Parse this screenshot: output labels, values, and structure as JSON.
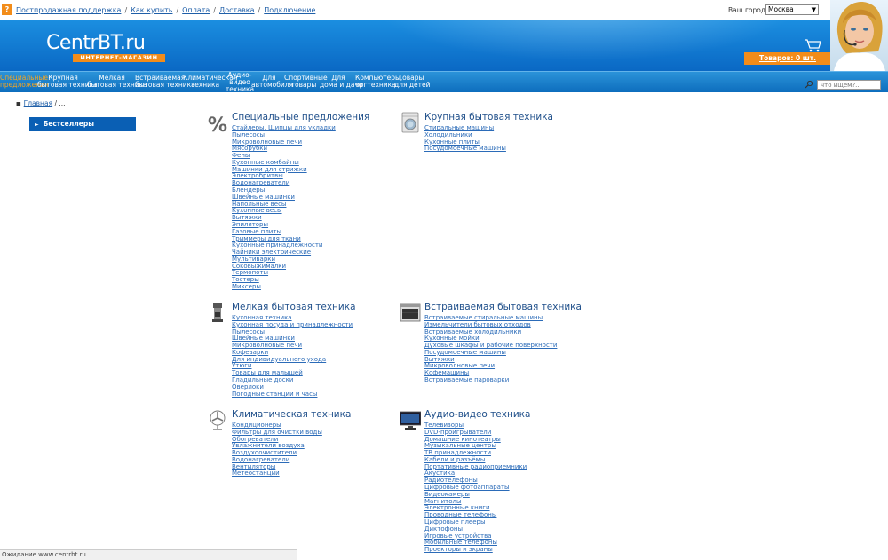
{
  "topbar": {
    "help_icon": "?",
    "links": [
      "Постпродажная поддержка",
      "Как купить",
      "Оплата",
      "Доставка",
      "Подключение"
    ],
    "city_label": "Ваш город:",
    "city_value": "Москва"
  },
  "header": {
    "logo_main": "CentrBT.ru",
    "logo_sub": "ИНТЕРНЕТ-МАГАЗИН",
    "cart_text": "Товаров: 0 шт."
  },
  "nav": [
    {
      "label": "Специальные\nпредложения",
      "active": true
    },
    {
      "label": "Крупная\nбытовая техника"
    },
    {
      "label": "Мелкая\nбытовая техника"
    },
    {
      "label": "Встраиваемая\nбытовая техника"
    },
    {
      "label": "Климатическая\nтехника"
    },
    {
      "label": "Аудио-\nвидео\nтехника"
    },
    {
      "label": "Для\nавтомобиля"
    },
    {
      "label": "Спортивные\nтовары"
    },
    {
      "label": "Для\nдома и дачи"
    },
    {
      "label": "Компьютеры,\nоргтехника"
    },
    {
      "label": "Товары\nдля детей"
    }
  ],
  "search": {
    "placeholder": "что ищем?.."
  },
  "breadcrumb": {
    "home": "Главная",
    "tail": " / ..."
  },
  "left_panel": {
    "bestsellers": "Бестселлеры"
  },
  "categories": [
    {
      "title": "Специальные предложения",
      "icon": "percent-icon",
      "items": [
        "Стайлеры, Щипцы для укладки",
        "Пылесосы",
        "Микроволновые печи",
        "Мясорубки",
        "Фены",
        "Кухонные комбайны",
        "Машинки для стрижки",
        "Электробритвы",
        "Водонагреватели",
        "Блендеры",
        "Швейные машинки",
        "Напольные весы",
        "Кухонные весы",
        "Вытяжки",
        "Эпиляторы",
        "Газовые плиты",
        "Триммеры для ткани",
        "Кухонные принадлежности",
        "Чайники электрические",
        "Мультиварки",
        "Соковыжималки",
        "Термопоты",
        "Тостеры",
        "Миксеры"
      ]
    },
    {
      "title": "Крупная бытовая техника",
      "icon": "washing-machine-icon",
      "items": [
        "Стиральные машины",
        "Холодильники",
        "Кухонные плиты",
        "Посудомоечные машины"
      ]
    },
    {
      "title": "Мелкая бытовая техника",
      "icon": "coffee-maker-icon",
      "items": [
        "Кухонная техника",
        "Кухонная посуда и принадлежности",
        "Пылесосы",
        "Швейные машинки",
        "Микроволновые печи",
        "Кофеварки",
        "Для индивидуального ухода",
        "Утюги",
        "Товары для малышей",
        "Гладильные доски",
        "Оверлоки",
        "Погодные станции и часы"
      ]
    },
    {
      "title": "Встраиваемая бытовая техника",
      "icon": "oven-icon",
      "items": [
        "Встраиваемые стиральные машины",
        "Измельчители бытовых отходов",
        "Встраиваемые холодильники",
        "Кухонные мойки",
        "Духовые шкафы и рабочие поверхности",
        "Посудомоечные машины",
        "Вытяжки",
        "Микроволновые печи",
        "Кофемашины",
        "Встраиваемые пароварки"
      ]
    },
    {
      "title": "Климатическая техника",
      "icon": "fan-icon",
      "items": [
        "Кондиционеры",
        "Фильтры для очистки воды",
        "Обогреватели",
        "Увлажнители воздуха",
        "Воздухоочистители",
        "Водонагреватели",
        "Вентиляторы",
        "Метеостанции"
      ]
    },
    {
      "title": "Аудио-видео техника",
      "icon": "tv-icon",
      "items": [
        "Телевизоры",
        "DVD-проигрыватели",
        "Домашние кинотеатры",
        "Музыкальные центры",
        "ТВ принадлежности",
        "Кабели и разъёмы",
        "Портативные радиоприемники",
        "Акустика",
        "Радиотелефоны",
        "Цифровые фотоаппараты",
        "Видеокамеры",
        "Магнитолы",
        "Электронные книги",
        "Проводные телефоны",
        "Цифровые плееры",
        "Диктофоны",
        "Игровые устройства",
        "Мобильные телефоны",
        "Проекторы и экраны"
      ]
    }
  ],
  "status": "Ожидание www.centrbt.ru..."
}
